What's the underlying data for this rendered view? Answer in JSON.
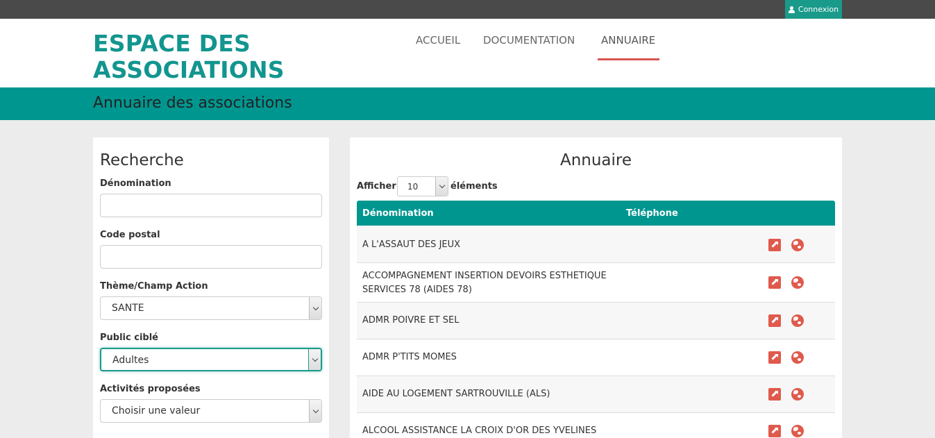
{
  "topbar": {
    "login_label": "Connexion"
  },
  "header": {
    "logo_line1": "ESPACE DES",
    "logo_line2": "ASSOCIATIONS",
    "nav": [
      {
        "label": "ACCUEIL"
      },
      {
        "label": "DOCUMENTATION"
      },
      {
        "label": "ANNUAIRE",
        "active": true
      }
    ]
  },
  "band": {
    "title": "Annuaire des associations"
  },
  "search": {
    "title": "Recherche",
    "denomination": {
      "label": "Dénomination",
      "value": ""
    },
    "postal_code": {
      "label": "Code postal",
      "value": ""
    },
    "theme": {
      "label": "Thème/Champ Action",
      "value": "SANTE"
    },
    "public": {
      "label": "Public ciblé",
      "value": "Adultes"
    },
    "activities": {
      "label": "Activités proposées",
      "value": "Choisir une valeur"
    }
  },
  "directory": {
    "title": "Annuaire",
    "show_label": "Afficher",
    "show_value": "10",
    "show_after": "éléments",
    "columns": [
      "Dénomination",
      "Téléphone"
    ],
    "rows": [
      {
        "name": "A L'ASSAUT DES JEUX",
        "phone": ""
      },
      {
        "name": "ACCOMPAGNEMENT INSERTION DEVOIRS ESTHETIQUE SERVICES 78 (AIDES 78)",
        "phone": ""
      },
      {
        "name": "ADMR POIVRE ET SEL",
        "phone": ""
      },
      {
        "name": "ADMR P'TITS MOMES",
        "phone": ""
      },
      {
        "name": "AIDE AU LOGEMENT SARTROUVILLE (ALS)",
        "phone": ""
      },
      {
        "name": "ALCOOL ASSISTANCE LA CROIX D'OR DES YVELINES",
        "phone": ""
      }
    ]
  },
  "colors": {
    "teal": "#009690",
    "logo": "#13958f",
    "accent_red": "#e05a4c",
    "topbar": "#4a4a4a"
  }
}
